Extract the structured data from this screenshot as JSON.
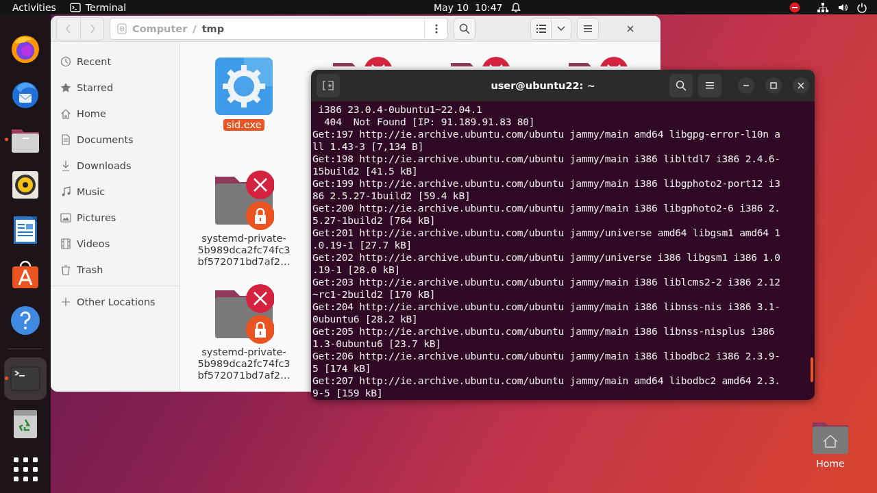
{
  "top_bar": {
    "activities": "Activities",
    "app": "Terminal",
    "clock": "May 10  10:47"
  },
  "dock": {
    "items": [
      {
        "kind": "firefox",
        "running": false,
        "selected": false
      },
      {
        "kind": "thunderbird",
        "running": false,
        "selected": false
      },
      {
        "kind": "files",
        "running": true,
        "selected": false
      },
      {
        "kind": "rhythmbox",
        "running": false,
        "selected": false
      },
      {
        "kind": "writer",
        "running": false,
        "selected": false
      },
      {
        "kind": "software",
        "running": false,
        "selected": false
      },
      {
        "kind": "help",
        "running": false,
        "selected": false
      },
      {
        "kind": "separator"
      },
      {
        "kind": "terminal",
        "running": true,
        "selected": true
      },
      {
        "kind": "trash",
        "running": false,
        "selected": false
      },
      {
        "kind": "apps",
        "running": false,
        "selected": false
      }
    ]
  },
  "files_window": {
    "path": [
      "Computer",
      "/",
      "tmp"
    ],
    "sidebar": {
      "items": [
        {
          "kind": "recent",
          "label": "Recent"
        },
        {
          "kind": "starred",
          "label": "Starred"
        },
        {
          "kind": "home",
          "label": "Home"
        },
        {
          "kind": "documents",
          "label": "Documents"
        },
        {
          "kind": "downloads",
          "label": "Downloads"
        },
        {
          "kind": "music",
          "label": "Music"
        },
        {
          "kind": "pictures",
          "label": "Pictures"
        },
        {
          "kind": "videos",
          "label": "Videos"
        },
        {
          "kind": "trash",
          "label": "Trash"
        },
        {
          "kind": "other",
          "label": "Other Locations"
        }
      ]
    },
    "rows": [
      [
        {
          "kind": "exe",
          "name": [
            "sid.exe"
          ],
          "selected": true
        },
        {
          "kind": "locked-folder"
        },
        {
          "kind": "locked-folder"
        },
        {
          "kind": "locked-folder"
        }
      ],
      [
        {
          "kind": "locked-folder",
          "name": [
            "systemd-private-",
            "5b989dca2fc74fc3",
            "bf572071bd7af2…"
          ],
          "selected": false
        }
      ],
      [
        {
          "kind": "locked-folder",
          "name": [
            "systemd-private-",
            "5b989dca2fc74fc3",
            "bf572071bd7af2…"
          ],
          "selected": false
        }
      ]
    ]
  },
  "terminal": {
    "title": "user@ubuntu22: ~",
    "lines": [
      " i386 23.0.4-0ubuntu1~22.04.1",
      "  404  Not Found [IP: 91.189.91.83 80]",
      "Get:197 http://ie.archive.ubuntu.com/ubuntu jammy/main amd64 libgpg-error-l10n a",
      "ll 1.43-3 [7,134 B]",
      "Get:198 http://ie.archive.ubuntu.com/ubuntu jammy/main i386 libltdl7 i386 2.4.6-",
      "15build2 [41.5 kB]",
      "Get:199 http://ie.archive.ubuntu.com/ubuntu jammy/main i386 libgphoto2-port12 i3",
      "86 2.5.27-1build2 [59.4 kB]",
      "Get:200 http://ie.archive.ubuntu.com/ubuntu jammy/main i386 libgphoto2-6 i386 2.",
      "5.27-1build2 [764 kB]",
      "Get:201 http://ie.archive.ubuntu.com/ubuntu jammy/universe amd64 libgsm1 amd64 1",
      ".0.19-1 [27.7 kB]",
      "Get:202 http://ie.archive.ubuntu.com/ubuntu jammy/universe i386 libgsm1 i386 1.0",
      ".19-1 [28.0 kB]",
      "Get:203 http://ie.archive.ubuntu.com/ubuntu jammy/main i386 liblcms2-2 i386 2.12",
      "~rc1-2build2 [170 kB]",
      "Get:204 http://ie.archive.ubuntu.com/ubuntu jammy/main i386 libnss-nis i386 3.1-",
      "0ubuntu6 [28.2 kB]",
      "Get:205 http://ie.archive.ubuntu.com/ubuntu jammy/main i386 libnss-nisplus i386 ",
      "1.3-0ubuntu6 [23.7 kB]",
      "Get:206 http://ie.archive.ubuntu.com/ubuntu jammy/main i386 libodbc2 i386 2.3.9-",
      "5 [174 kB]",
      "Get:207 http://ie.archive.ubuntu.com/ubuntu jammy/main amd64 libodbc2 amd64 2.3.",
      "9-5 [159 kB]"
    ]
  },
  "desktop_icons": [
    {
      "kind": "home",
      "label": "Home"
    }
  ]
}
